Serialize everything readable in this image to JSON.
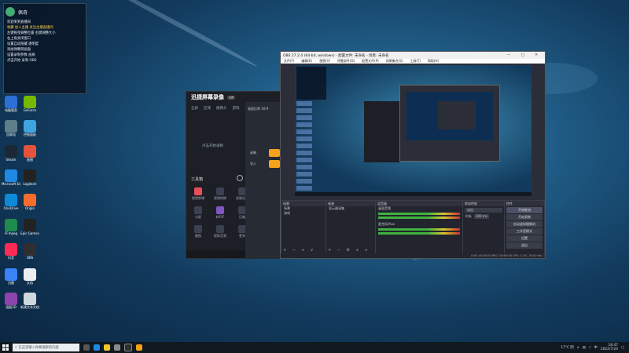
{
  "chat": {
    "username": "佩奇",
    "lines": [
      "欢迎来到直播间",
      "收藏 加入主播 关注主播直播间",
      "左键拖曳调整位置 右键调整大小",
      "右上角关闭窗口",
      "设置自动隐藏 透明度",
      "添加弹幕到画面",
      "设置录制参数 画质",
      "点击开始 录制 OBS"
    ]
  },
  "desktop_icons": [
    {
      "label": "电脑管家",
      "color": "#2c6fd6"
    },
    {
      "label": "GeForce",
      "color": "#76b900"
    },
    {
      "label": "回收站",
      "color": "#607d8b"
    },
    {
      "label": "控制面板",
      "color": "#3fa3e0"
    },
    {
      "label": "Steam",
      "color": "#1b2838"
    },
    {
      "label": "画图",
      "color": "#e5533d"
    },
    {
      "label": "Microsoft Edge",
      "color": "#1e88e5"
    },
    {
      "label": "Logitech",
      "color": "#222"
    },
    {
      "label": "OneDrive",
      "color": "#0d8bd9"
    },
    {
      "label": "Origin",
      "color": "#f56c2d"
    },
    {
      "label": "FFmpeg",
      "color": "#1f8b4c"
    },
    {
      "label": "Epic Games",
      "color": "#222"
    },
    {
      "label": "抖音",
      "color": "#fe2c55"
    },
    {
      "label": "OBS",
      "color": "#302e31"
    },
    {
      "label": "迅雷",
      "color": "#3b82f6"
    },
    {
      "label": "文档",
      "color": "#eceff1"
    },
    {
      "label": "画图3D",
      "color": "#8e44ad"
    },
    {
      "label": "新建文本文档",
      "color": "#cfd8dc"
    }
  ],
  "recorder": {
    "title": "迅捷屏幕录像",
    "badge": "VIP",
    "tabs": [
      "全屏",
      "区域",
      "摄像头",
      "游戏"
    ],
    "center_label": "点击开始录制",
    "section": "工具箱",
    "tools": [
      {
        "label": "视频剪辑"
      },
      {
        "label": "视频转换"
      },
      {
        "label": "录制设置"
      },
      {
        "label": "分屏"
      },
      {
        "label": "转GIF"
      },
      {
        "label": "压缩"
      },
      {
        "label": "截图"
      },
      {
        "label": "提取音频"
      },
      {
        "label": "更多"
      }
    ],
    "right_header": "画面比例 16:9",
    "right_items": [
      "录制",
      "导入"
    ]
  },
  "obs": {
    "title": "OBS 27.2.4 (64-bit, windows) - 配置文件: 未命名 - 场景: 未命名",
    "menu": [
      "文件(F)",
      "编辑(E)",
      "视图(V)",
      "停靠部件(D)",
      "配置文件(P)",
      "场景集合(S)",
      "工具(T)",
      "帮助(H)"
    ],
    "docks": {
      "scenes": {
        "header": "场景",
        "items": [
          "场景",
          "游戏"
        ]
      },
      "sources": {
        "header": "来源",
        "items": [
          "显示器采集"
        ]
      },
      "mixer": {
        "header": "混音器",
        "channels": [
          "桌面音频",
          "麦克风/Aux"
        ]
      },
      "transitions": {
        "header": "转场特效",
        "label": "淡出",
        "duration_label": "时长",
        "duration": "300 ms"
      },
      "controls": {
        "header": "控件",
        "buttons": [
          "开始推流",
          "开始录制",
          "启动虚拟摄像机",
          "工作室模式",
          "设置",
          "退出"
        ]
      }
    },
    "status": "LIVE: 00:00:00  REC: 00:00:00  CPU: 2.1%, 30.00 fps"
  },
  "taskbar": {
    "search_placeholder": "在这里输入你要搜索的内容",
    "apps": [
      "task-view",
      "edge",
      "file-explorer",
      "store",
      "obs",
      "recorder"
    ],
    "weather": "17°C 阴",
    "ime": "中",
    "time": "18:47",
    "date": "2022/7/24"
  }
}
